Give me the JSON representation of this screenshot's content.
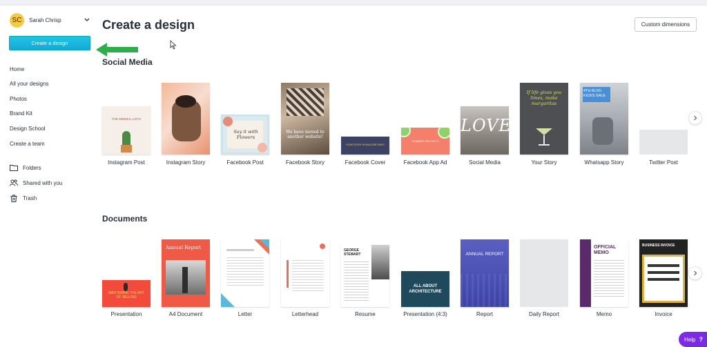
{
  "user": {
    "initials": "SC",
    "name": "Sarah Chrisp"
  },
  "sidebar": {
    "create_label": "Create a design",
    "nav": [
      "Home",
      "All your designs",
      "Photos",
      "Brand Kit",
      "Design School",
      "Create a team"
    ],
    "folders": [
      {
        "label": "Folders",
        "icon": "folder-icon"
      },
      {
        "label": "Shared with you",
        "icon": "people-icon"
      },
      {
        "label": "Trash",
        "icon": "trash-icon"
      }
    ]
  },
  "main": {
    "title": "Create a design",
    "custom_dimensions": "Custom dimensions",
    "sections": [
      {
        "title": "Social Media",
        "items": [
          "Instagram Post",
          "Instagram Story",
          "Facebook Post",
          "Facebook Story",
          "Facebook Cover",
          "Facebook App Ad",
          "Social Media",
          "Your Story",
          "Whatsapp Story",
          "Twitter Post"
        ]
      },
      {
        "title": "Documents",
        "items": [
          "Presentation",
          "A4 Document",
          "Letter",
          "Letterhead",
          "Resume",
          "Presentation (4:3)",
          "Report",
          "Daily Report",
          "Memo",
          "Invoice"
        ]
      }
    ]
  },
  "thumb_text": {
    "insta_post": "THE MINIMAL LISTS",
    "fb_post": "Say it with Flowers",
    "fb_story": "We have moved to another website!",
    "fb_cover": "YOUR STORY SHOULD BE RIGHT",
    "fb_app_ad": "SUMMER DELIGHTS",
    "social": "LOVE",
    "your_story": "If life gives you limes, make margaritas",
    "whatsapp": "4TH BLVD. KICKS SALE",
    "presentation": "MASTERING THE ART OF SELLING",
    "a4": "Annual Report",
    "resume": "GEORGE STEWART",
    "pres43": "ALL ABOUT ARCHITECTURE",
    "report": "ANNUAL REPORT",
    "memo": "OFFICIAL MEMO",
    "invoice": "BUSINESS INVOICE"
  },
  "help": {
    "label": "Help",
    "symbol": "?"
  },
  "colors": {
    "accent": "#21c4e6",
    "help": "#7d2ae8",
    "arrow": "#2eae4a"
  }
}
